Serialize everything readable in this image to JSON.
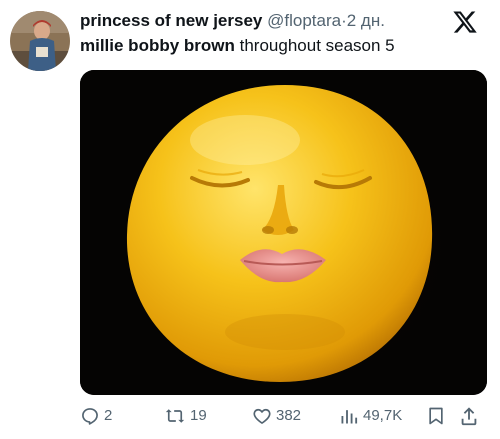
{
  "tweet": {
    "display_name": "princess of new jersey",
    "handle": "@floptara",
    "separator": "·",
    "time": "2 дн.",
    "text_bold": "millie bobby brown",
    "text_rest": " throughout season 5",
    "media_description_icon": "lemon-face-image"
  },
  "brand": {
    "logo_icon": "x-logo-icon"
  },
  "actions": {
    "reply": {
      "icon": "reply-icon",
      "count": "2"
    },
    "repost": {
      "icon": "repost-icon",
      "count": "19"
    },
    "like": {
      "icon": "heart-icon",
      "count": "382"
    },
    "views": {
      "icon": "views-icon",
      "count": "49,7K"
    },
    "bookmark": {
      "icon": "bookmark-icon"
    },
    "share": {
      "icon": "share-icon"
    }
  },
  "colors": {
    "text_primary": "#0f1419",
    "text_secondary": "#536471",
    "lemon": "#f2b90f"
  }
}
